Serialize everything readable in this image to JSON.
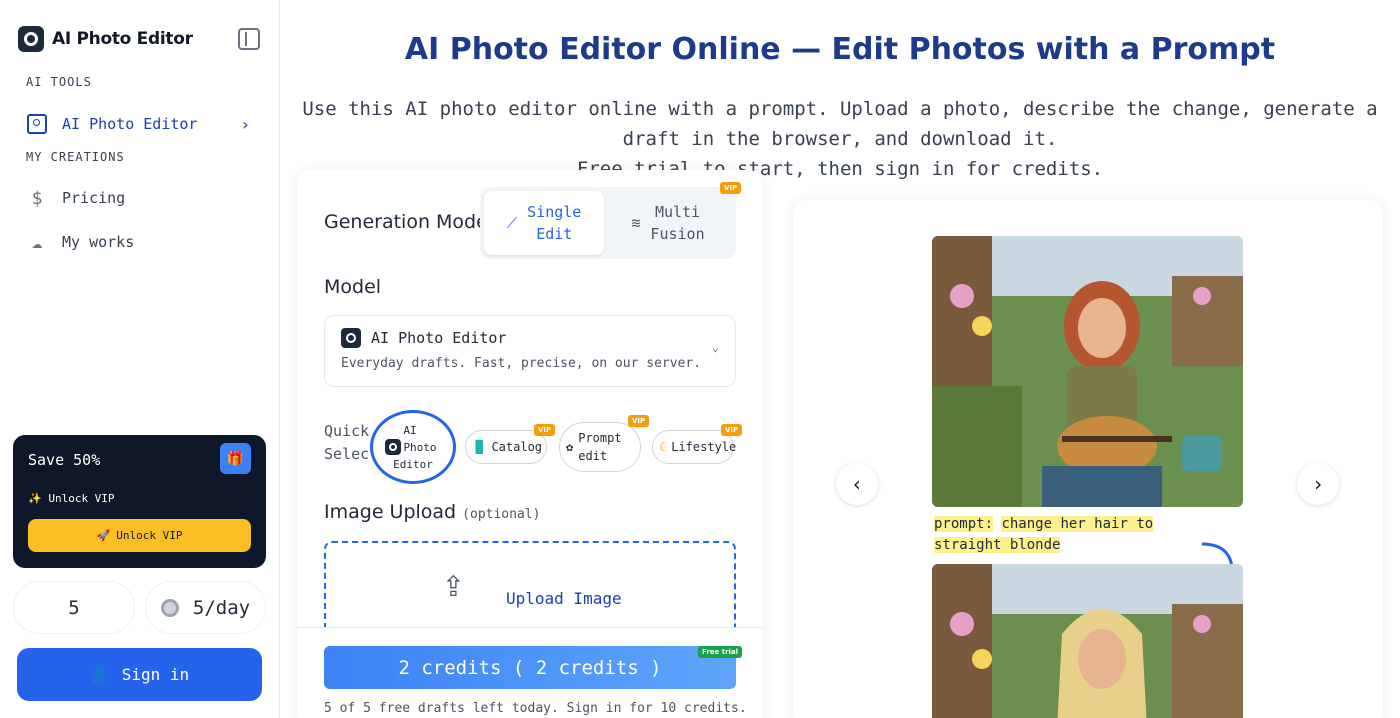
{
  "brand": {
    "name": "AI Photo Editor"
  },
  "sidebar": {
    "section_tools": "AI TOOLS",
    "section_creations": "MY CREATIONS",
    "items": [
      {
        "label": "AI Photo Editor",
        "icon": "image-icon",
        "active": true
      },
      {
        "label": "Pricing",
        "icon": "dollar-icon"
      },
      {
        "label": "My works",
        "icon": "cloud-icon"
      }
    ],
    "promo": {
      "title": "Save 50%",
      "subtitle": "Unlock VIP",
      "button": "Unlock VIP"
    },
    "credits_count": "5",
    "daily": "5/day",
    "signin": "Sign in"
  },
  "header": {
    "title": "AI Photo Editor Online — Edit Photos with a Prompt",
    "lead_line1": "Use this AI photo editor online with a prompt. Upload a photo, describe the change, generate a draft in the browser, and download it.",
    "lead_line2": "Free trial to start, then sign in for credits."
  },
  "form": {
    "generation_mode_label": "Generation Mode",
    "modes": [
      {
        "line1": "Single",
        "line2": "Edit",
        "active": true
      },
      {
        "line1": "Multi",
        "line2": "Fusion",
        "vip": true
      }
    ],
    "vip_tag": "VIP",
    "model_label": "Model",
    "model": {
      "name": "AI Photo Editor",
      "desc": "Everyday drafts. Fast, precise, on our server."
    },
    "quick_label_1": "Quick",
    "quick_label_2": "Select:",
    "quick": [
      {
        "label_1": "AI",
        "label_2": "Photo",
        "label_3": "Editor",
        "selected": true
      },
      {
        "label": "Catalog",
        "vip": true
      },
      {
        "label_1": "Prompt",
        "label_2": "edit",
        "vip": true
      },
      {
        "label": "Lifestyle",
        "vip": true
      }
    ],
    "upload_label": "Image Upload",
    "upload_optional": "(optional)",
    "upload_text": "Upload Image",
    "generate_button": "2 credits ( 2 credits )",
    "free_trial_tag": "Free trial",
    "note": "5 of 5 free drafts left today. Sign in for 10 credits."
  },
  "preview": {
    "prompt_key": "prompt:",
    "prompt_text": "change her hair to straight blonde",
    "prev_icon": "chevron-left-icon",
    "next_icon": "chevron-right-icon"
  }
}
